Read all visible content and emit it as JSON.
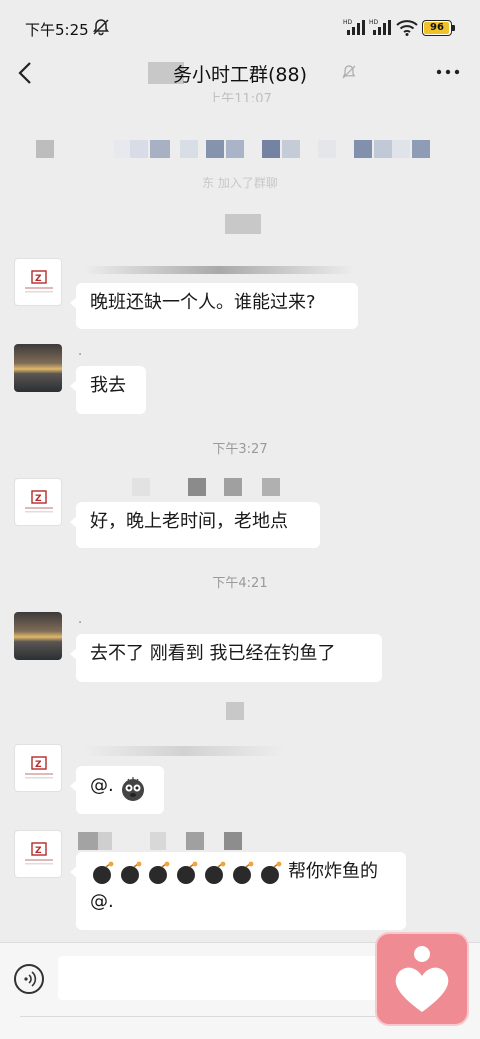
{
  "status_bar": {
    "time": "下午5:25",
    "battery": "96"
  },
  "nav": {
    "title": "务小时工群(88)"
  },
  "system": {
    "partial_date": "上午11:07",
    "join_notice": "东 加入了群聊"
  },
  "messages": [
    {
      "text": "晚班还缺一个人。谁能过来?"
    },
    {
      "text": "我去",
      "sender": "."
    },
    {
      "text": "好，晚上老时间，老地点"
    },
    {
      "text": "去不了 刚看到 我已经在钓鱼了",
      "sender": "."
    },
    {
      "text": "@."
    },
    {
      "text_line2": "帮你炸鱼的",
      "text_line3": "@."
    }
  ],
  "times": {
    "t1": "下午3:27",
    "t2": "下午4:21"
  },
  "icons": [
    "back-arrow-icon",
    "mute-bell-icon",
    "more-icon",
    "voice-icon",
    "bomb-icon",
    "heart-icon"
  ]
}
